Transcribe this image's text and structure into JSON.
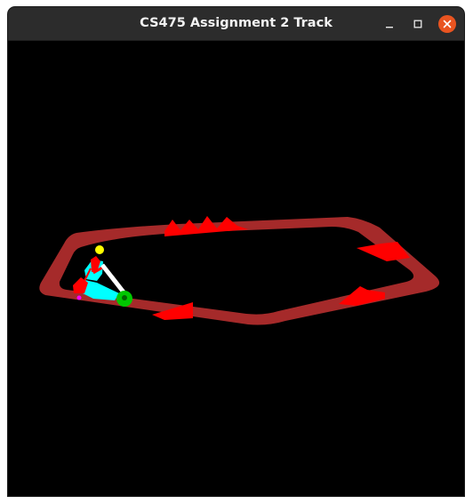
{
  "window": {
    "title": "CS475 Assignment 2 Track",
    "controls": [
      "minimize-icon",
      "maximize-icon",
      "close-icon"
    ],
    "close_color": "#e95420"
  },
  "scene": {
    "background": "#000000",
    "track_color": "#a52a2a",
    "ramp_color": "#ff0000",
    "rider_colors": [
      "#00ffff",
      "#ffff00",
      "#ff0000",
      "#ffffff",
      "#00c800",
      "#ff00ff"
    ]
  }
}
